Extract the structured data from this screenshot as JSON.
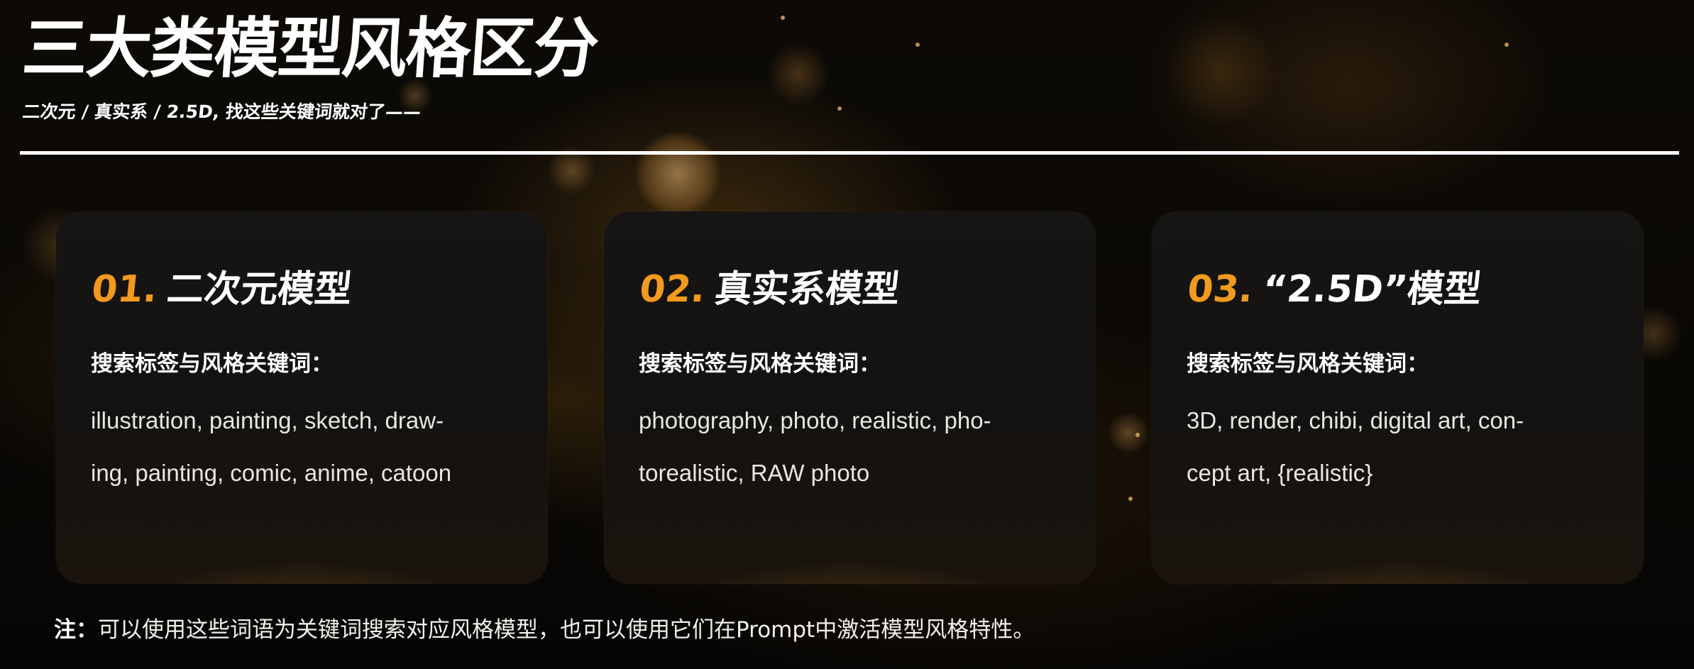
{
  "header": {
    "title": "三大类模型风格区分",
    "subtitle": "二次元 / 真实系 / 2.5D, 找这些关键词就对了——"
  },
  "cards": [
    {
      "number": "01.",
      "name": "二次元模型",
      "label": "搜索标签与风格关键词：",
      "lines": [
        "illustration, painting, sketch, draw-",
        "ing, painting, comic, anime, catoon"
      ]
    },
    {
      "number": "02.",
      "name": "真实系模型",
      "label": "搜索标签与风格关键词：",
      "lines": [
        "photography, photo, realistic, pho-",
        "torealistic, RAW photo"
      ]
    },
    {
      "number": "03.",
      "name": "“2.5D”模型",
      "label": "搜索标签与风格关键词：",
      "lines": [
        "3D, render, chibi, digital art, con-",
        "cept art, {realistic}"
      ]
    }
  ],
  "note": {
    "label": "注：",
    "text": "可以使用这些词语为关键词搜索对应风格模型，也可以使用它们在Prompt中激活模型风格特性。"
  },
  "colors": {
    "accent": "#f29a1e",
    "card_background": "#151412",
    "text": "#ffffff"
  }
}
